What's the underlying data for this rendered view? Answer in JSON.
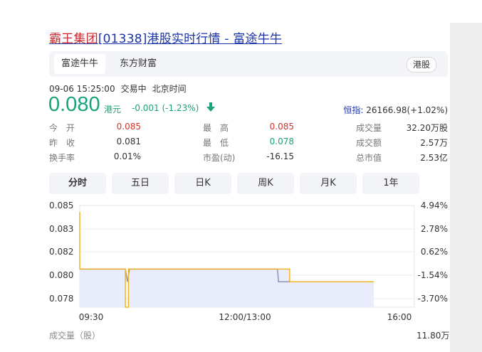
{
  "title": {
    "highlight": "霸王集团",
    "rest": "[01338]港股实时行情 - 富途牛牛"
  },
  "tabs": [
    {
      "label": "富途牛牛"
    },
    {
      "label": "东方财富"
    }
  ],
  "market_tag": "港股",
  "status": {
    "datetime": "09-06 15:25:00",
    "state": "交易中",
    "timezone": "北京时间"
  },
  "quote": {
    "price": "0.080",
    "currency": "港元",
    "change": "-0.001 (-1.23%)",
    "direction_icon": "down-arrow-icon"
  },
  "index": {
    "label": "恒指:",
    "value": "26166.98(+1.02%)"
  },
  "stats": [
    {
      "label": "今　开",
      "value": "0.085",
      "color": "#d0352d"
    },
    {
      "label": "最　高",
      "value": "0.085",
      "color": "#d0352d"
    },
    {
      "label": "成交量",
      "value": "32.20万股",
      "color": "#333333"
    },
    {
      "label": "昨　收",
      "value": "0.081",
      "color": "#333333"
    },
    {
      "label": "最　低",
      "value": "0.078",
      "color": "#1aa37a"
    },
    {
      "label": "成交额",
      "value": "2.57万",
      "color": "#333333"
    },
    {
      "label": "换手率",
      "value": "0.01%",
      "color": "#333333"
    },
    {
      "label": "市盈(动)",
      "value": "-16.15",
      "color": "#333333"
    },
    {
      "label": "总市值",
      "value": "2.53亿",
      "color": "#333333"
    }
  ],
  "range_tabs": [
    "分时",
    "五日",
    "日K",
    "周K",
    "月K",
    "1年"
  ],
  "active_range": "分时",
  "colors": {
    "price_line": "#f0b429",
    "avg_line": "#8a93b8",
    "area_fill": "#e8ecfb",
    "down": "#1aa37a",
    "up": "#d0352d"
  },
  "chart_data": {
    "type": "line",
    "y_ticks": [
      "0.085",
      "0.083",
      "0.082",
      "0.080",
      "0.078"
    ],
    "y_ticks_right": [
      "4.94%",
      "2.78%",
      "0.62%",
      "-1.54%",
      "-3.70%"
    ],
    "x_ticks": [
      "09:30",
      "12:00/13:00",
      "16:00"
    ],
    "ylim": [
      0.0775,
      0.0855
    ],
    "session_minutes": 330,
    "series": [
      {
        "x": [
          0,
          0,
          1,
          45,
          45,
          46,
          48,
          48,
          49,
          195,
          196,
          207,
          207,
          290
        ],
        "values": [
          0.085,
          0.0805,
          0.0805,
          0.0805,
          0.0775,
          0.0775,
          0.0775,
          0.0805,
          0.0805,
          0.0805,
          0.0805,
          0.0805,
          0.0795,
          0.0795
        ]
      },
      {
        "x": [
          0,
          1,
          45,
          47,
          49,
          195,
          196,
          207,
          290
        ],
        "values": [
          0.0805,
          0.0805,
          0.0805,
          0.0795,
          0.0805,
          0.0805,
          0.0795,
          0.0795,
          0.0795
        ]
      }
    ]
  },
  "volume": {
    "label": "成交量（股）",
    "max": "11.80万"
  }
}
